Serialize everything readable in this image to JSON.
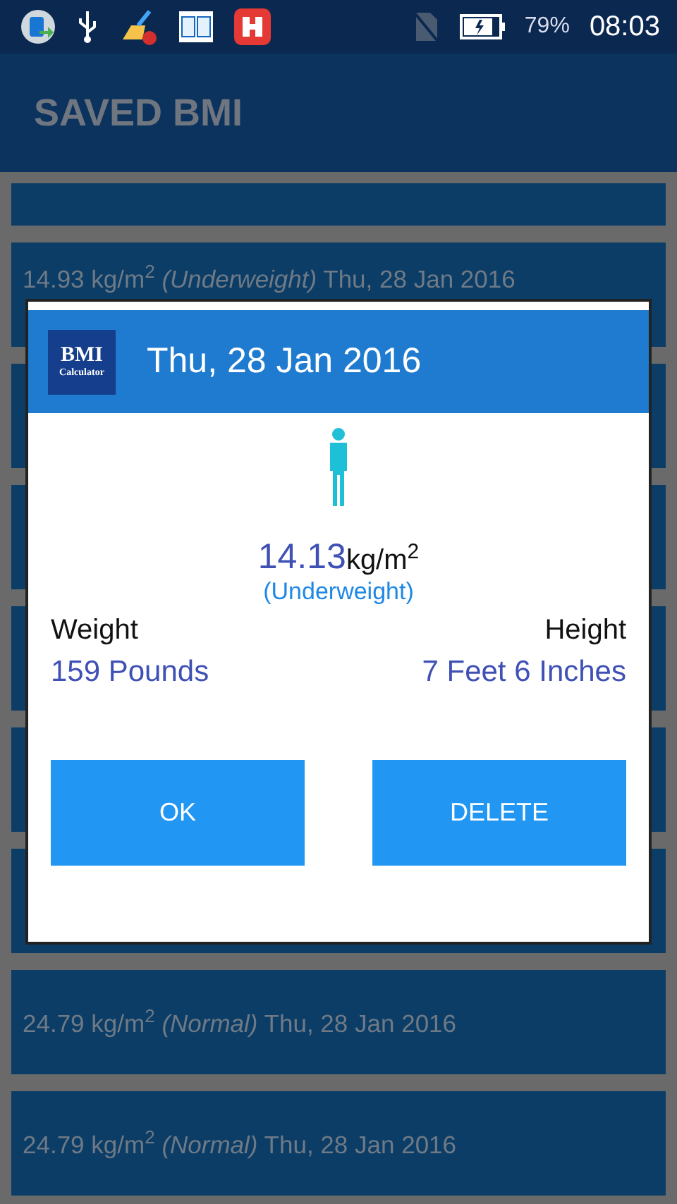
{
  "status_bar": {
    "battery": "79%",
    "time": "08:03"
  },
  "app_bar": {
    "title": "SAVED BMI"
  },
  "saved_list": [
    {
      "text": "14.93 kg/m$^{2}$ *(Underweight)* Thu, 28 Jan 2016"
    },
    {
      "text": "24.79 kg/m$^{2}$ *(Normal)* Thu, 28 Jan 2016"
    },
    {
      "text": "24.79 kg/m$^{2}$ *(Normal)* Thu, 28 Jan 2016"
    }
  ],
  "dialog": {
    "logo": {
      "title": "BMI",
      "subtitle": "Calculator"
    },
    "title": "Thu, 28 Jan 2016",
    "bmi_value": "14.13",
    "bmi_unit": "kg/m$^{2}$",
    "category": "(Underweight)",
    "weight": {
      "label": "Weight",
      "value": "159 Pounds"
    },
    "height": {
      "label": "Height",
      "value": "7 Feet 6 Inches"
    },
    "buttons": [
      "OK",
      "DELETE"
    ]
  }
}
